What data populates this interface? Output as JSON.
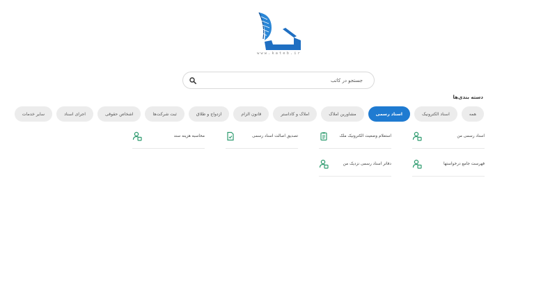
{
  "logo": {
    "url_text": "www.kateb.ir",
    "brand_color": "#1f6fc2"
  },
  "search": {
    "placeholder": "جستجو در کاتب"
  },
  "categories_title": "دسته بندی‌ها",
  "categories": [
    {
      "label": "همه",
      "active": false
    },
    {
      "label": "اسناد الکترونیک",
      "active": false
    },
    {
      "label": "اسناد رسمی",
      "active": true
    },
    {
      "label": "مشاورین املاک",
      "active": false
    },
    {
      "label": "املاک و کاداستر",
      "active": false
    },
    {
      "label": "قانون الزام",
      "active": false
    },
    {
      "label": "ازدواج و طلاق",
      "active": false
    },
    {
      "label": "ثبت شرکت‌ها",
      "active": false
    },
    {
      "label": "اشخاص حقوقی",
      "active": false
    },
    {
      "label": "اجرای اسناد",
      "active": false
    },
    {
      "label": "سایر خدمات",
      "active": false
    }
  ],
  "services": [
    {
      "label": "اسناد رسمی من",
      "icon": "user-document-icon"
    },
    {
      "label": "استعلام وضعیت الکترونیک ملک",
      "icon": "clipboard-icon"
    },
    {
      "label": "تصدیق اصالت اسناد رسمی",
      "icon": "verified-document-icon"
    },
    {
      "label": "محاسبه هزینه سند",
      "icon": "user-document-icon"
    },
    {
      "label": "فهرست جامع درخواستها",
      "icon": "user-document-icon"
    },
    {
      "label": "دفاتر اسناد رسمی نزدیک من",
      "icon": "user-document-icon"
    }
  ],
  "colors": {
    "accent": "#1f7bd1",
    "icon_green": "#2e9b6f",
    "chip_bg": "#ececec"
  }
}
